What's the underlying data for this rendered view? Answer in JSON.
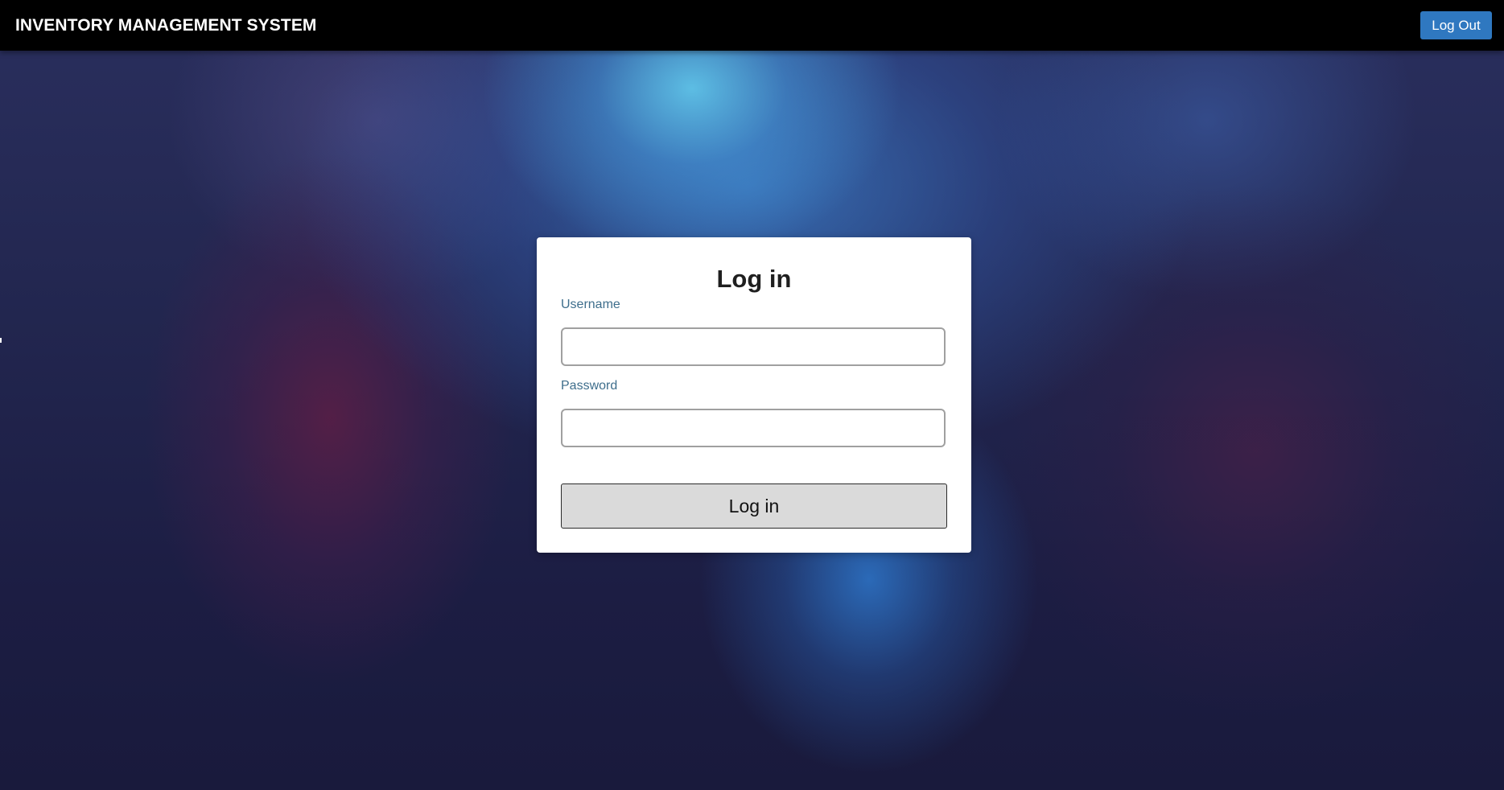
{
  "navbar": {
    "brand": "INVENTORY MANAGEMENT SYSTEM",
    "logout_label": "Log Out"
  },
  "login": {
    "title": "Log in",
    "username_label": "Username",
    "username_value": "",
    "password_label": "Password",
    "password_value": "",
    "submit_label": "Log in"
  },
  "colors": {
    "navbar_bg": "#000000",
    "logout_button": "#2f78c0",
    "field_label": "#3e6e8c",
    "submit_bg": "#dadada"
  }
}
